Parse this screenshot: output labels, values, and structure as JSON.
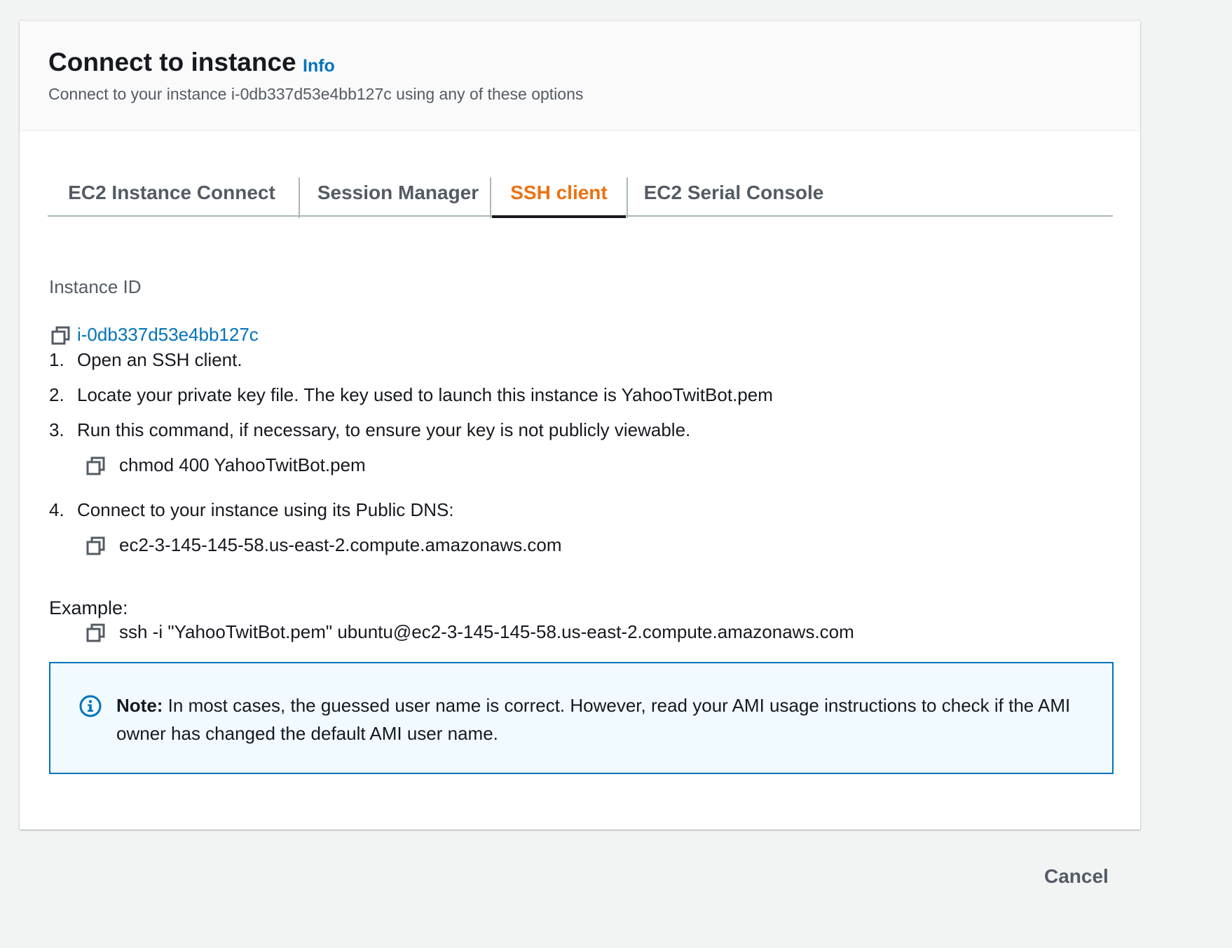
{
  "modal": {
    "title": "Connect to instance",
    "info_label": "Info",
    "subtitle": "Connect to your instance i-0db337d53e4bb127c using any of these options"
  },
  "tabs": [
    {
      "label": "EC2 Instance Connect",
      "active": false
    },
    {
      "label": "Session Manager",
      "active": false
    },
    {
      "label": "SSH client",
      "active": true
    },
    {
      "label": "EC2 Serial Console",
      "active": false
    }
  ],
  "instance": {
    "label": "Instance ID",
    "id": "i-0db337d53e4bb127c"
  },
  "steps": [
    {
      "num": "1.",
      "text": "Open an SSH client."
    },
    {
      "num": "2.",
      "text": "Locate your private key file. The key used to launch this instance is YahooTwitBot.pem"
    },
    {
      "num": "3.",
      "text": "Run this command, if necessary, to ensure your key is not publicly viewable."
    },
    {
      "num": "4.",
      "text": "Connect to your instance using its Public DNS:"
    }
  ],
  "commands": {
    "chmod": "chmod 400 YahooTwitBot.pem",
    "dns": "ec2-3-145-145-58.us-east-2.compute.amazonaws.com",
    "example_label": "Example:",
    "ssh": "ssh -i \"YahooTwitBot.pem\" ubuntu@ec2-3-145-145-58.us-east-2.compute.amazonaws.com"
  },
  "note": {
    "bold": "Note:",
    "text": " In most cases, the guessed user name is correct. However, read your AMI usage instructions to check if the AMI owner has changed the default AMI user name."
  },
  "footer": {
    "cancel_label": "Cancel"
  },
  "colors": {
    "accent_orange": "#ec7211",
    "link_blue": "#0073bb",
    "text_dark": "#16191f",
    "text_grey": "#545b64"
  },
  "icons": {
    "copy": "copy-icon",
    "info": "info-circle-icon"
  }
}
